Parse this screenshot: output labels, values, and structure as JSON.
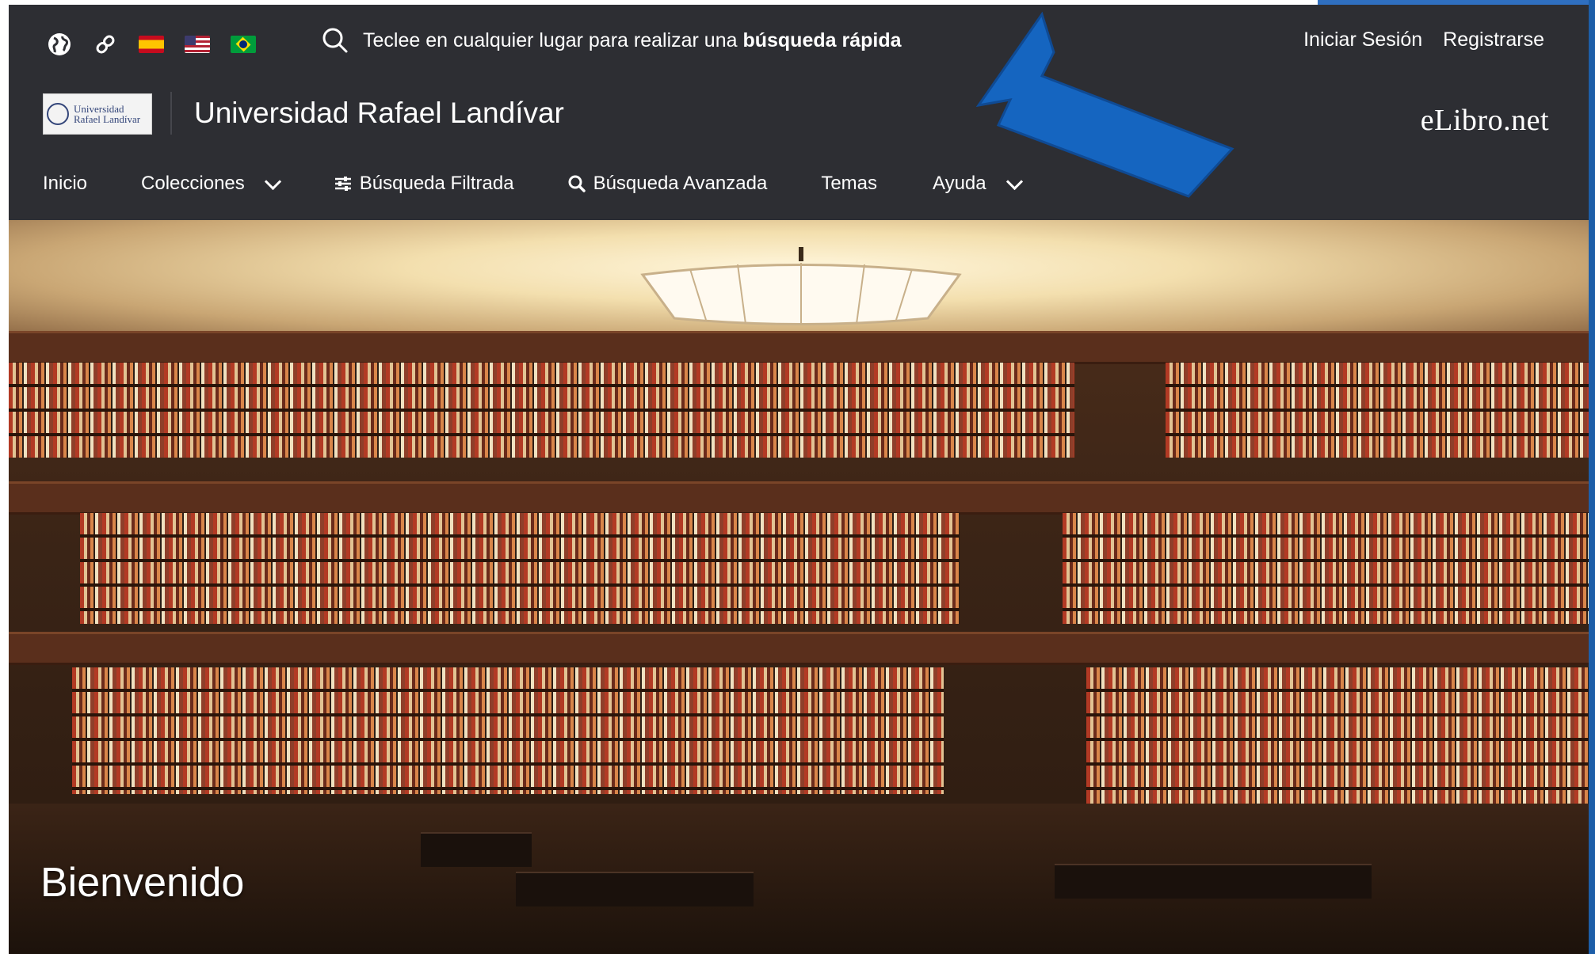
{
  "top_bar": {
    "icons": [
      {
        "icon": "globe-icon"
      },
      {
        "icon": "link-icon"
      },
      {
        "icon": "flag-spain-icon"
      },
      {
        "icon": "flag-usa-icon"
      },
      {
        "icon": "flag-brazil-icon"
      }
    ],
    "quick_search": {
      "icon": "search-icon",
      "text_prefix": "Teclee en cualquier lugar para realizar una ",
      "text_bold": "búsqueda rápida"
    },
    "login_label": "Iniciar Sesión",
    "register_label": "Registrarse"
  },
  "brand": {
    "logo_text_line1": "Universidad",
    "logo_text_line2": "Rafael Landívar",
    "university_name": "Universidad Rafael Landívar",
    "provider": "eLibro.net"
  },
  "nav": {
    "items": [
      {
        "label": "Inicio"
      },
      {
        "label": "Colecciones",
        "icon": "chevron-down-icon"
      },
      {
        "label": "Búsqueda Filtrada",
        "icon": "sliders-icon"
      },
      {
        "label": "Búsqueda Avanzada",
        "icon": "search-icon"
      },
      {
        "label": "Temas"
      },
      {
        "label": "Ayuda",
        "icon": "chevron-down-icon"
      }
    ]
  },
  "hero": {
    "welcome": "Bienvenido",
    "image": "library-interior-photo"
  },
  "colors": {
    "header_bg": "#2d2e33",
    "annotation_arrow": "#1565c0"
  }
}
